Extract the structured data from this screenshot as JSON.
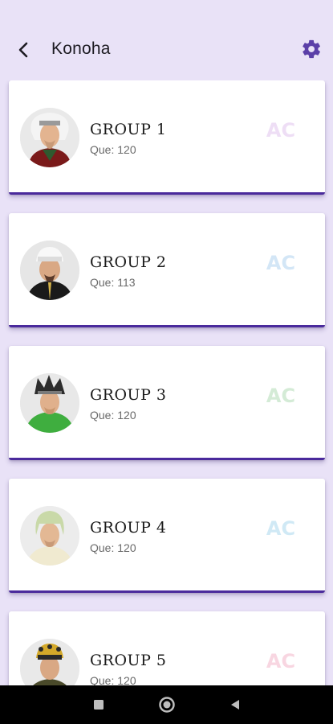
{
  "header": {
    "title": "Konoha",
    "back_icon": "arrow-back-icon",
    "settings_icon": "gear-icon"
  },
  "colors": {
    "background": "#e9e2f7",
    "accent": "#5b3fa8",
    "card_border": "#4a2a9c"
  },
  "groups": [
    {
      "name": "GROUP 1",
      "subtitle": "Que: 120",
      "logo_color": "#b56bd6",
      "avatar": "sage-white-hair"
    },
    {
      "name": "GROUP 2",
      "subtitle": "Que: 113",
      "logo_color": "#3a8fd9",
      "avatar": "white-beanie"
    },
    {
      "name": "GROUP 3",
      "subtitle": "Que: 120",
      "logo_color": "#3ea84a",
      "avatar": "green-spiky"
    },
    {
      "name": "GROUP 4",
      "subtitle": "Que: 120",
      "logo_color": "#2f9fd6",
      "avatar": "white-hair"
    },
    {
      "name": "GROUP 5",
      "subtitle": "Que: 120",
      "logo_color": "#e04a7a",
      "avatar": "headband"
    }
  ],
  "nav": {
    "recents_icon": "square-icon",
    "home_icon": "circle-icon",
    "back_icon": "triangle-back-icon"
  }
}
